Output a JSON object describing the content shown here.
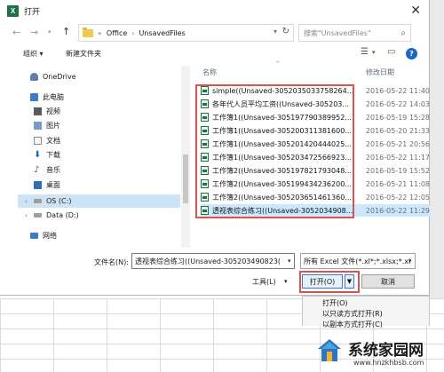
{
  "window": {
    "title": "打开",
    "app_icon": "excel-icon"
  },
  "address": {
    "path": [
      "Office",
      "UnsavedFiles"
    ],
    "prefix": "«"
  },
  "search": {
    "placeholder": "搜索\"UnsavedFiles\""
  },
  "toolbar": {
    "organize": "组织 ▾",
    "new_folder": "新建文件夹"
  },
  "nav_pane": {
    "items": [
      {
        "label": "OneDrive",
        "icon": "cloud-icon"
      },
      {
        "label": "此电脑",
        "icon": "computer-icon"
      },
      {
        "label": "视频",
        "icon": "video-icon"
      },
      {
        "label": "图片",
        "icon": "picture-icon"
      },
      {
        "label": "文档",
        "icon": "document-icon"
      },
      {
        "label": "下载",
        "icon": "download-icon"
      },
      {
        "label": "音乐",
        "icon": "music-icon"
      },
      {
        "label": "桌面",
        "icon": "desktop-icon"
      },
      {
        "label": "OS (C:)",
        "icon": "drive-icon",
        "selected": true
      },
      {
        "label": "Data (D:)",
        "icon": "drive-icon"
      },
      {
        "label": "网络",
        "icon": "network-icon"
      }
    ]
  },
  "file_list": {
    "columns": {
      "name": "名称",
      "modified": "修改日期"
    },
    "files": [
      {
        "name": "simple((Unsaved-3052035033758264...",
        "date": "2016-05-22 11:40"
      },
      {
        "name": "各年代人员平均工资((Unsaved-305203...",
        "date": "2016-05-22 14:03"
      },
      {
        "name": "工作簿1((Unsaved-305197790389952...",
        "date": "2016-05-19 15:28"
      },
      {
        "name": "工作簿1((Unsaved-305200311381600...",
        "date": "2016-05-20 21:33"
      },
      {
        "name": "工作簿1((Unsaved-305201420444025...",
        "date": "2016-05-21 20:56"
      },
      {
        "name": "工作簿1((Unsaved-305203472566923...",
        "date": "2016-05-22 11:17"
      },
      {
        "name": "工作簿2((Unsaved-305197821793048...",
        "date": "2016-05-19 15:52"
      },
      {
        "name": "工作簿2((Unsaved-305199434236200...",
        "date": "2016-05-21 11:08"
      },
      {
        "name": "工作簿2((Unsaved-305203651461360...",
        "date": "2016-05-22 12:05"
      },
      {
        "name": "透视表综合练习((Unsaved-3052034908...",
        "date": "2016-05-22 11:29",
        "selected": true
      }
    ]
  },
  "filename": {
    "label": "文件名(N):",
    "value": "透视表综合练习((Unsaved-305203490823("
  },
  "filter": {
    "value": "所有 Excel 文件(*.xl*;*.xlsx;*.xl"
  },
  "buttons": {
    "tools": "工具(L)",
    "open": "打开(O)",
    "cancel": "取消"
  },
  "open_menu": {
    "items": [
      "打开(O)",
      "以只读方式打开(R)",
      "以副本方式打开(C)"
    ]
  },
  "watermark": {
    "title": "系统家园网",
    "url": "www.hnzkhbsb.com"
  }
}
